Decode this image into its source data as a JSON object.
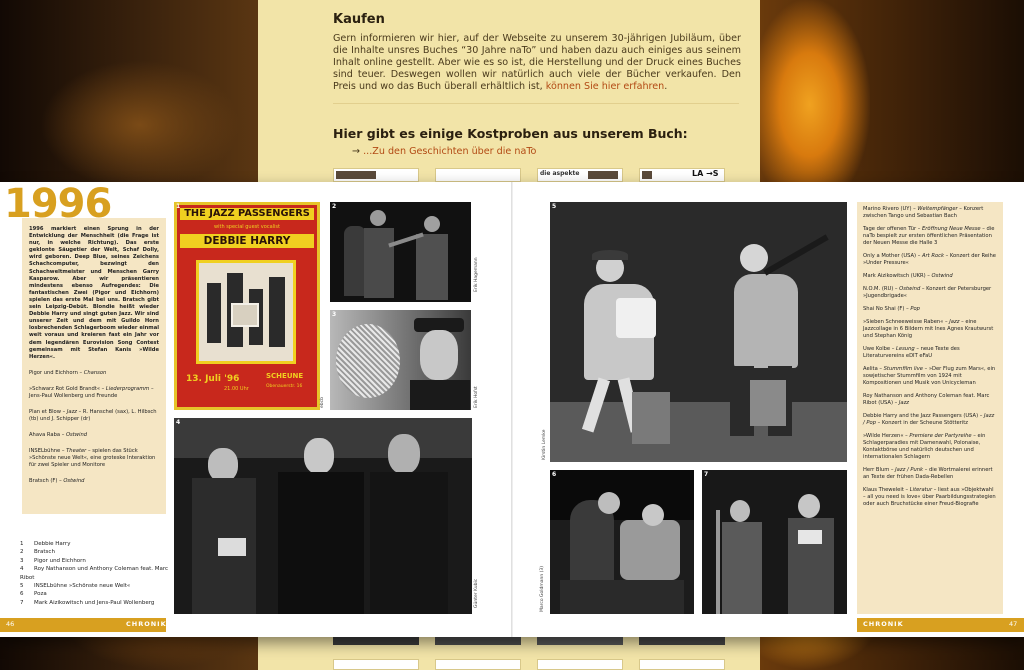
{
  "website": {
    "heading": "Kaufen",
    "paragraph": "Gern informieren wir hier, auf der Webseite zu unserem 30-jährigen Jubiläum, über die Inhalte unsres Buches “30 Jahre naTo” und haben dazu auch einiges aus seinem Inhalt online gestellt. Aber wie es so ist, die Herstellung und der Druck eines Buches sind teuer. Deswegen wollen wir natürlich auch viele der Bücher verkaufen. Den Preis und wo das Buch überall erhältlich ist,",
    "paragraph_link": "können Sie hier erfahren",
    "paragraph_end": ".",
    "heading2": "Hier gibt es einige Kostproben aus unserem Buch:",
    "arrow": "→",
    "stories_link": "...Zu den Geschichten über die naTo",
    "thumb_label_1": "die aspekte",
    "thumb_label_2": "LA →S"
  },
  "spread": {
    "year": "1996",
    "intro": "1996 markiert einen Sprung in der Entwicklung der Menschheit (die Frage ist nur, in welche Richtung). Das erste geklonte Säugetier der Welt, Schaf Dolly, wird geboren. Deep Blue, seines Zeichens Schachcomputer, bezwingt den Schachweltmeister und Menschen Garry Kasparow. Aber wir präsentieren mindestens ebenso Aufregendes: Die fantastischen Zwei (Pigor und Eichhorn) spielen das erste Mal bei uns. Bratsch gibt sein Leipzig-Debüt. Blondie heißt wieder Debbie Harry und singt guten Jazz. Wir sind unserer Zeit und dem mit Guildo Horn losbrechenden Schlagerboom wieder einmal weit voraus und kreieren fast ein Jahr vor dem legendären Eurovision Song Contest gemeinsam mit Stefan Kanis »Wilde Herzen«.",
    "left_entries": [
      {
        "name": "Pigor und Eichhorn – ",
        "italic": "Chanson",
        "rest": ""
      },
      {
        "name": "»Schwarz Rot Gold Brandt« – ",
        "italic": "Liederprogramm",
        "rest": " – Jens-Paul Wollenberg und Freunde"
      },
      {
        "name": "Plan et Blow – ",
        "italic": "Jazz",
        "rest": " – R. Hanschel (sax), L. Hilbsch (tb) und J. Schipper (dr)"
      },
      {
        "name": "Ahava Raba – ",
        "italic": "Ostwind",
        "rest": ""
      },
      {
        "name": "INSELbühne – ",
        "italic": "Theater",
        "rest": " – spielen das Stück »Schönste neue Welt«, eine groteske Interaktion für zwei Spieler und Monitore"
      },
      {
        "name": "Bratsch (F) – ",
        "italic": "Ostwind",
        "rest": ""
      }
    ],
    "captions": [
      {
        "n": "1",
        "t": "Debbie Harry"
      },
      {
        "n": "2",
        "t": "Bratsch"
      },
      {
        "n": "3",
        "t": "Pigor und Eichhorn"
      },
      {
        "n": "4",
        "t": "Roy Nathanson und Anthony Coleman feat. Marc Ribot"
      },
      {
        "n": "5",
        "t": "INSELbühne »Schönste neue Welt«"
      },
      {
        "n": "6",
        "t": "Poza"
      },
      {
        "n": "7",
        "t": "Mark Aizikowitsch und Jens-Paul Wollenberg"
      }
    ],
    "right_entries": [
      {
        "name": "Marino Rivero (UY) – ",
        "italic": "Weltempfänger",
        "rest": " – Konzert zwischen Tango und Sebastian Bach"
      },
      {
        "name": "Tage der offenen Tür – ",
        "italic": "Eröffnung Neue Messe",
        "rest": " – die naTo bespielt zur ersten öffentlichen Präsentation der Neuen Messe die Halle 3"
      },
      {
        "name": "Only a Mother (USA) – ",
        "italic": "Art Rock",
        "rest": " – Konzert der Reihe »Under Pressure«"
      },
      {
        "name": "Mark Aizikowitsch (UKR) – ",
        "italic": "Ostwind",
        "rest": ""
      },
      {
        "name": "N.O.M. (RU) – ",
        "italic": "Ostwind",
        "rest": " – Konzert der Petersburger »Jugendbrigade«"
      },
      {
        "name": "Shai No Shai (F) – ",
        "italic": "Pop",
        "rest": ""
      },
      {
        "name": "»Sieben Schneeweisse Raben« – ",
        "italic": "Jazz",
        "rest": " – eine Jazzcollage in 6 Bildern mit Ines Agnes Krautwurst und Stephan König"
      },
      {
        "name": "Uwe Kolbe – ",
        "italic": "Lesung",
        "rest": " – neue Texte des Literaturvereins eDIT eFaU"
      },
      {
        "name": "Aelita – ",
        "italic": "Stummfilm live",
        "rest": " – »Der Flug zum Mars«, ein sowjetischer Stummfilm von 1924 mit Kompositionen und Musik von Unicycleman"
      },
      {
        "name": "Roy Nathanson and Anthony Coleman feat. Marc Ribot (USA) – ",
        "italic": "Jazz",
        "rest": ""
      },
      {
        "name": "Debbie Harry and the Jazz Passengers (USA) – ",
        "italic": "Jazz / Pop",
        "rest": " – Konzert in der Scheune Stötteritz"
      },
      {
        "name": "»Wilde Herzen« – ",
        "italic": "Premiere der Partyreihe",
        "rest": " – ein Schlagerparadies mit Damenwahl, Polonaise, Kontaktbörse und natürlich deutschen und internationalen Schlagern"
      },
      {
        "name": "Herr Blum – ",
        "italic": "Jazz / Punk",
        "rest": " – die Wortmalerei erinnert an Texte der frühen Dada-Rebellen"
      },
      {
        "name": "Klaus Theweleit – ",
        "italic": "Literatur",
        "rest": " – liest aus »Objektwahl – all you need is love« über Paarbildungsstrategien oder auch Bruchstücke einer Freud-Biografie"
      }
    ],
    "footer_left_page": "46",
    "footer_left_label": "CHRONIK",
    "footer_right_label": "CHRONIK",
    "footer_right_page": "47",
    "poster": {
      "title": "THE JAZZ PASSENGERS",
      "subtitle": "with special guest vocalist",
      "headliner": "DEBBIE HARRY",
      "date": "13. Juli '96",
      "time": "21.00 Uhr",
      "venue": "SCHEUNE",
      "address": "Obenauerstr. 16"
    },
    "photo_numbers": [
      "1",
      "2",
      "3",
      "4",
      "5",
      "6",
      "7"
    ],
    "credits": [
      "Erik Hagemann",
      "ebcb",
      "Erik Hofst",
      "Günter Kubic",
      "Kirstin Lemke",
      "Marco Goldmann (3)"
    ]
  },
  "colors": {
    "accent_gold": "#d8a020",
    "tan_box": "#f5e6c4",
    "web_bg": "#f2e4a8",
    "link": "#b24a14"
  }
}
